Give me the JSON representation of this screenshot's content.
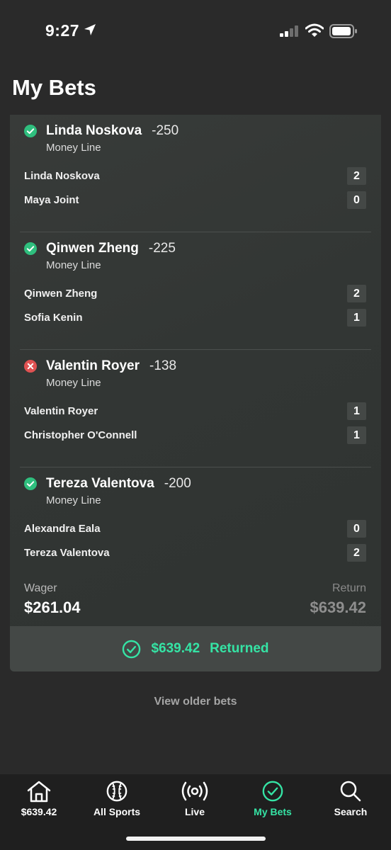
{
  "status_bar": {
    "time": "9:27"
  },
  "page_title": "My Bets",
  "bets": [
    {
      "result": "win",
      "name": "Linda Noskova",
      "odds": "-250",
      "type": "Money Line",
      "players": [
        {
          "name": "Linda Noskova",
          "score": "2"
        },
        {
          "name": "Maya Joint",
          "score": "0"
        }
      ]
    },
    {
      "result": "win",
      "name": "Qinwen Zheng",
      "odds": "-225",
      "type": "Money Line",
      "players": [
        {
          "name": "Qinwen Zheng",
          "score": "2"
        },
        {
          "name": "Sofia Kenin",
          "score": "1"
        }
      ]
    },
    {
      "result": "loss",
      "name": "Valentin Royer",
      "odds": "-138",
      "type": "Money Line",
      "players": [
        {
          "name": "Valentin Royer",
          "score": "1"
        },
        {
          "name": "Christopher O'Connell",
          "score": "1"
        }
      ]
    },
    {
      "result": "win",
      "name": "Tereza Valentova",
      "odds": "-200",
      "type": "Money Line",
      "players": [
        {
          "name": "Alexandra Eala",
          "score": "0"
        },
        {
          "name": "Tereza Valentova",
          "score": "2"
        }
      ]
    }
  ],
  "summary": {
    "wager_label": "Wager",
    "wager_value": "$261.04",
    "return_label": "Return",
    "return_value": "$639.42",
    "returned_amount": "$639.42",
    "returned_text": "Returned"
  },
  "view_older": "View older bets",
  "tabs": [
    {
      "label": "$639.42",
      "icon": "home-icon"
    },
    {
      "label": "All Sports",
      "icon": "baseball-icon"
    },
    {
      "label": "Live",
      "icon": "broadcast-icon"
    },
    {
      "label": "My Bets",
      "icon": "check-circle-icon",
      "active": true
    },
    {
      "label": "Search",
      "icon": "search-icon"
    }
  ],
  "colors": {
    "accent": "#35e4a5",
    "win": "#2fbf7e",
    "loss": "#e05252",
    "background": "#2a2a2a",
    "card": "#353937"
  }
}
